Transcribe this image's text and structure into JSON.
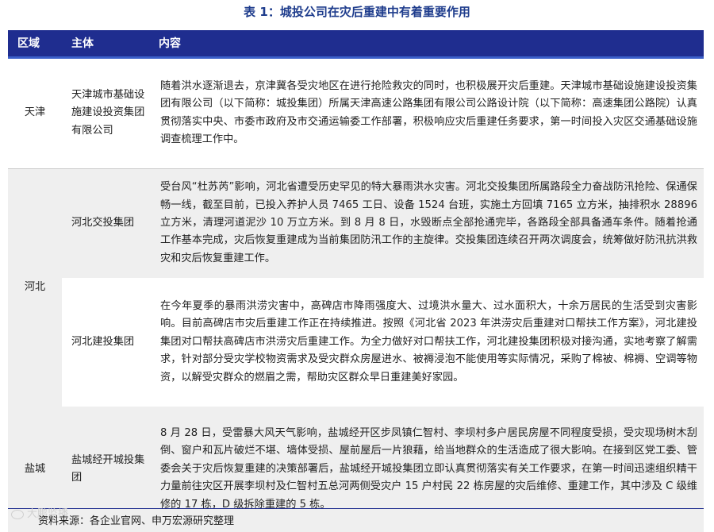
{
  "title": "表 1：城投公司在灾后重建中有着重要作用",
  "table": {
    "headers": [
      "区域",
      "主体",
      "内容"
    ],
    "rows": [
      {
        "region": "天津",
        "entity": "天津城市基础设施建设投资集团有限公司",
        "content": "随着洪水逐渐退去，京津冀各受灾地区在进行抢险救灾的同时，也积极展开灾后重建。天津城市基础设施建设投资集团有限公司（以下简称：城投集团）所属天津高速公路集团有限公司公路设计院（以下简称：高速集团公路院）认真贯彻落实中央、市委市政府及市交通运输委工作部署，积极响应灾后重建任务要求，第一时间投入灾区交通基础设施调查梳理工作中。"
      },
      {
        "region": "河北",
        "entity": "河北交投集团",
        "content": "受台风“杜苏芮”影响，河北省遭受历史罕见的特大暴雨洪水灾害。河北交投集团所属路段全力奋战防汛抢险、保通保畅一线，截至目前，已投入养护人员 7465 工日、设备 1524 台班，实施土方回填 7165 立方米，抽排积水 28896 立方米，清理河道泥沙 10 万立方米。到 8 月 8 日，水毁断点全部抢通完毕，各路段全部具备通车条件。随着抢通工作基本完成，灾后恢复重建成为当前集团防汛工作的主旋律。交投集团连续召开两次调度会，统筹做好防汛抗洪救灾和灾后恢复重建工作。"
      },
      {
        "region": "河北",
        "entity": "河北建投集团",
        "content": "在今年夏季的暴雨洪涝灾害中，高碑店市降雨强度大、过境洪水量大、过水面积大，十余万居民的生活受到灾害影响。目前高碑店市灾后重建工作正在持续推进。按照《河北省 2023 年洪涝灾后重建对口帮扶工作方案》，河北建投集团对口帮扶高碑店市洪涝灾后重建工作。为全力做好对口帮扶工作，河北建投集团积极对接沟通，实地考察了解需求，针对部分受灾学校物资需求及受灾群众房屋进水、被褥浸泡不能使用等实际情况，采购了棉被、棉褥、空调等物资，以解受灾群众的燃眉之需，帮助灾区群众早日重建美好家园。"
      },
      {
        "region": "盐城",
        "entity": "盐城经开城投集团",
        "content": "8 月 28 日，受雷暴大风天气影响，盐城经开区步凤镇仁智村、李坝村多户居民房屋不同程度受损，受灾现场树木刮倒、窗户和瓦片破烂不堪、墙体受损、屋前屋后一片狼藉，给当地群众的生活造成了很大影响。在接到区党工委、管委会关于灾后恢复重建的决策部署后，盐城经开城投集团立即认真贯彻落实有关工作要求，在第一时间迅速组织精干力量前往灾区开展李坝村及仁智村五总河两侧受灾户 15 户村民 22 栋房屋的灾后维修、重建工作，其中涉及 C 级维修的 17 栋，D 级拆除重建的 5 栋。"
      }
    ]
  },
  "footer": {
    "source": "资料来源：各企业官网、申万宏源研究整理",
    "watermark": "大鹏监播"
  },
  "colors": {
    "header_bg": "#1f2d8f",
    "title": "#1e3c8c",
    "row_grey": "#efefef"
  }
}
